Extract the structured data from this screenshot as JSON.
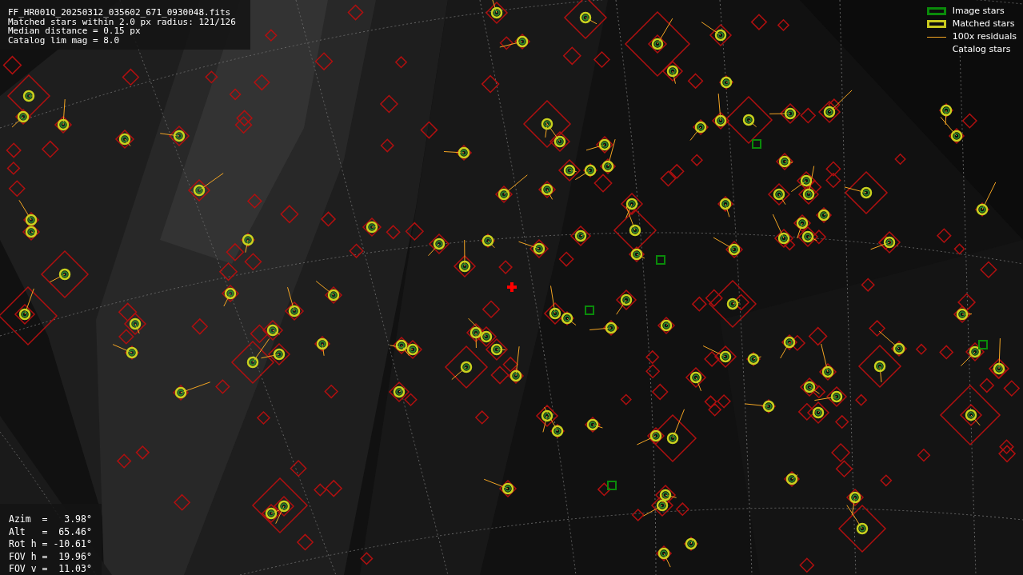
{
  "file_info": {
    "lines": [
      "FF_HR001Q_20250312_035602_671_0930048.fits",
      "Matched stars within 2.0 px radius: 121/126",
      "Median distance = 0.15 px",
      "Catalog lim mag = 8.0"
    ]
  },
  "pointing": {
    "lines": [
      "Azim  =   3.98°",
      "Alt   =  65.46°",
      "Rot h = -10.61°",
      "FOV h =  19.96°",
      "FOV v =  11.03°"
    ]
  },
  "legend": [
    {
      "label": "Image stars"
    },
    {
      "kind": "matched",
      "label": "Matched stars"
    },
    {
      "kind": "residual",
      "label": "100x residuals"
    },
    {
      "kind": "catalog",
      "label": "Catalog stars"
    }
  ]
}
